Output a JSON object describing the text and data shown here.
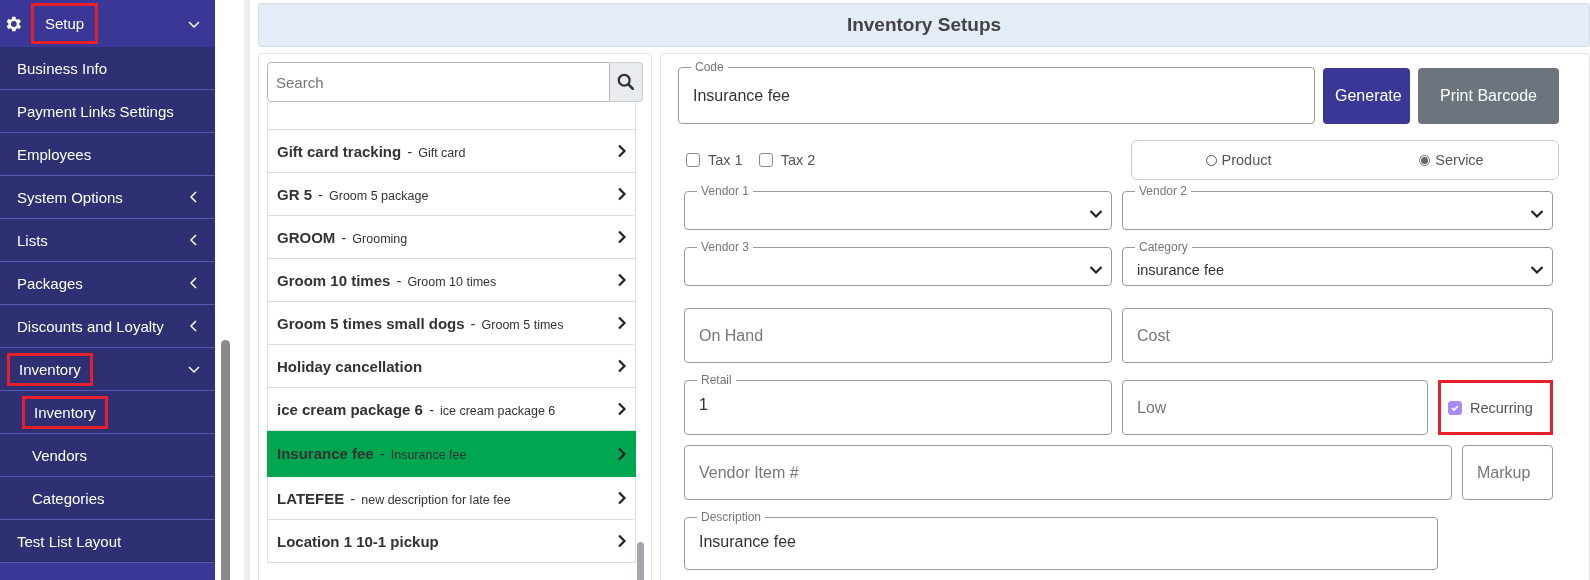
{
  "sidebar": {
    "header": {
      "label": "Setup",
      "expanded": true,
      "highlighted": true
    },
    "items": [
      {
        "label": "Business Info",
        "kind": "link",
        "highlighted": false
      },
      {
        "label": "Payment Links Settings",
        "kind": "link",
        "highlighted": false
      },
      {
        "label": "Employees",
        "kind": "link",
        "highlighted": false
      },
      {
        "label": "System Options",
        "kind": "group",
        "expanded": false,
        "highlighted": false
      },
      {
        "label": "Lists",
        "kind": "group",
        "expanded": false,
        "highlighted": false
      },
      {
        "label": "Packages",
        "kind": "group",
        "expanded": false,
        "highlighted": false
      },
      {
        "label": "Discounts and Loyalty",
        "kind": "group",
        "expanded": false,
        "highlighted": false
      },
      {
        "label": "Inventory",
        "kind": "group",
        "expanded": true,
        "highlighted": true,
        "children": [
          {
            "label": "Inventory",
            "highlighted": true
          },
          {
            "label": "Vendors",
            "highlighted": false
          },
          {
            "label": "Categories",
            "highlighted": false
          }
        ]
      },
      {
        "label": "Test List Layout",
        "kind": "link",
        "highlighted": false
      }
    ]
  },
  "page_title": "Inventory Setups",
  "search": {
    "placeholder": "Search"
  },
  "items": [
    {
      "code": "Gift card tracking",
      "separator": "-",
      "description": "Gift card",
      "selected": false
    },
    {
      "code": "GR 5",
      "separator": "-",
      "description": "Groom 5 package",
      "selected": false
    },
    {
      "code": "GROOM",
      "separator": "-",
      "description": "Grooming",
      "selected": false
    },
    {
      "code": "Groom 10 times",
      "separator": "-",
      "description": "Groom 10 times",
      "selected": false
    },
    {
      "code": "Groom 5 times small dogs",
      "separator": "-",
      "description": "Groom 5 times",
      "selected": false
    },
    {
      "code": "Holiday cancellation",
      "selected": false
    },
    {
      "code": "ice cream package 6",
      "separator": "-",
      "description": "ice cream package 6",
      "selected": false
    },
    {
      "code": "Insurance fee",
      "separator": "-",
      "description": "Insurance fee",
      "selected": true
    },
    {
      "code": "LATEFEE",
      "separator": "-",
      "description": "new description for late fee",
      "selected": false
    },
    {
      "code": "Location 1 10-1 pickup",
      "selected": false
    }
  ],
  "form": {
    "code": {
      "label": "Code",
      "value": "Insurance fee"
    },
    "buttons": [
      {
        "label": "Generate",
        "kind": "primary"
      },
      {
        "label": "Print Barcode",
        "kind": "secondary"
      }
    ],
    "taxes": [
      {
        "label": "Tax 1",
        "checked": false
      },
      {
        "label": "Tax 2",
        "checked": false
      }
    ],
    "item_type": [
      {
        "label": "Product",
        "selected": false
      },
      {
        "label": "Service",
        "selected": true
      }
    ],
    "fields": [
      {
        "kind": "select",
        "label": "Vendor 1"
      },
      {
        "kind": "select",
        "label": "Vendor 2"
      },
      {
        "kind": "select",
        "label": "Vendor 3"
      },
      {
        "kind": "select",
        "label": "Category",
        "value": "insurance fee"
      },
      {
        "kind": "text",
        "placeholder": "On Hand"
      },
      {
        "kind": "text",
        "placeholder": "Cost"
      },
      {
        "kind": "text",
        "label": "Retail",
        "value": "1"
      },
      {
        "kind": "text",
        "placeholder": "Low"
      },
      {
        "kind": "check",
        "label": "Recurring",
        "checked": true,
        "highlighted": true
      },
      {
        "kind": "text",
        "placeholder": "Vendor Item #"
      },
      {
        "kind": "text",
        "placeholder": "Markup"
      },
      {
        "kind": "text",
        "label": "Description",
        "value": "Insurance fee"
      }
    ]
  }
}
